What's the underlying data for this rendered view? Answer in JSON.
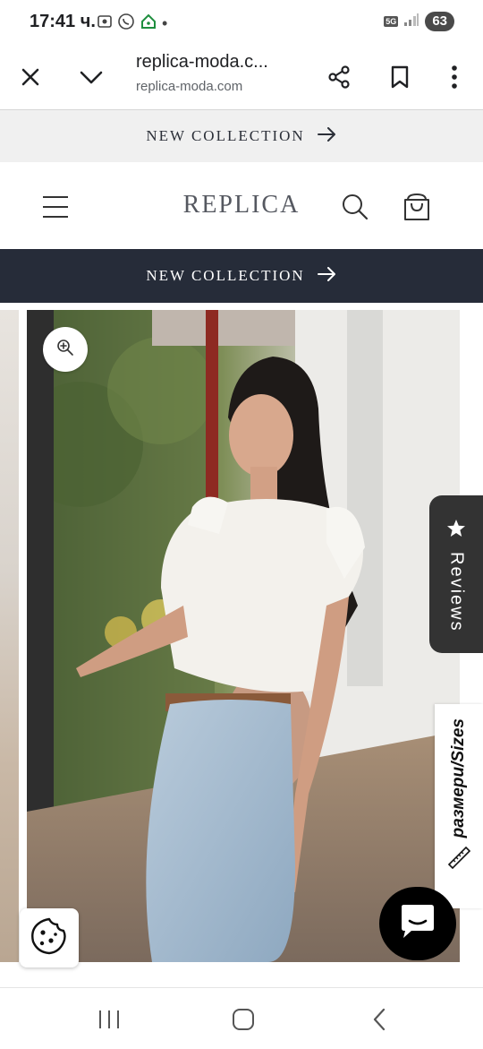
{
  "status_bar": {
    "time": "17:41 ч.",
    "network": "5G",
    "battery": "63"
  },
  "toolbar": {
    "page_title": "replica-moda.c...",
    "url": "replica-moda.com",
    "close_icon": "close-icon",
    "collapse_icon": "chevron-down-icon",
    "share_icon": "share-icon",
    "bookmark_icon": "bookmark-icon",
    "menu_icon": "more-vert-icon"
  },
  "announcement_top": {
    "text": "NEW COLLECTION"
  },
  "header": {
    "logo": "REPLICA",
    "menu_icon": "hamburger-icon",
    "search_icon": "search-icon",
    "cart_icon": "cart-icon"
  },
  "announcement_dark": {
    "text": "NEW COLLECTION"
  },
  "gallery": {
    "zoom_icon": "zoom-in-icon"
  },
  "reviews_tab": {
    "label": "Reviews",
    "icon": "star-icon"
  },
  "sizes_tab": {
    "label": "размери/Sizes",
    "icon": "ruler-icon"
  },
  "cookie_button": {
    "icon": "cookie-icon"
  },
  "chat_button": {
    "icon": "chat-icon"
  },
  "nav_bar": {
    "recents_icon": "recents-icon",
    "home_icon": "home-icon",
    "back_icon": "back-icon"
  },
  "colors": {
    "dark_banner": "#262c39",
    "light_banner": "#f0f0f0",
    "reviews_tab": "#333333"
  }
}
